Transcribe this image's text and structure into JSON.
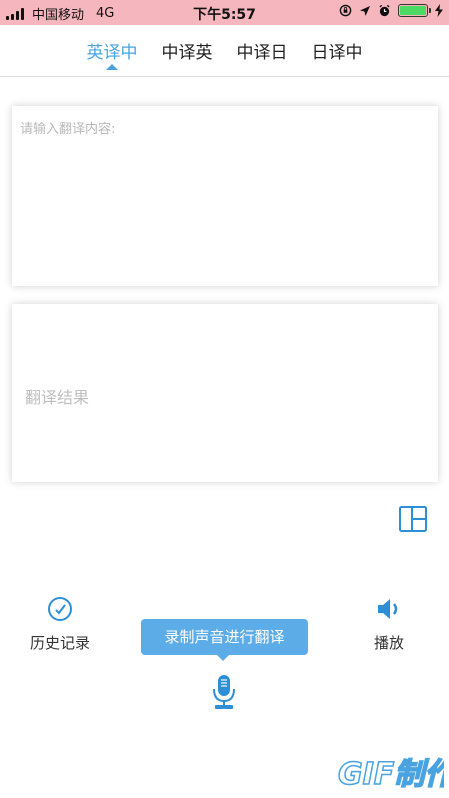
{
  "status_bar": {
    "carrier": "中国移动",
    "network": "4G",
    "time": "下午5:57",
    "battery_level": 1.0,
    "colors": {
      "background": "#f6b6bd",
      "battery": "#4cd964"
    },
    "icons": [
      "signal-icon",
      "rotation-lock-icon",
      "location-icon",
      "alarm-icon",
      "battery-icon",
      "charging-icon"
    ]
  },
  "tabs": {
    "items": [
      {
        "label": "英译中",
        "active": true
      },
      {
        "label": "中译英",
        "active": false
      },
      {
        "label": "中译日",
        "active": false
      },
      {
        "label": "日译中",
        "active": false
      }
    ],
    "accent_color": "#4aa3e0"
  },
  "input": {
    "placeholder": "请输入翻译内容:",
    "value": ""
  },
  "output": {
    "placeholder": "翻译结果"
  },
  "controls": {
    "history_label": "历史记录",
    "play_label": "播放",
    "record_tooltip": "录制声音进行翻译",
    "icons": [
      "layout-icon",
      "clock-icon",
      "speaker-icon",
      "microphone-icon"
    ],
    "accent_color": "#2d8fd5",
    "tooltip_color": "#5cace8"
  },
  "watermark": {
    "text": "GIF制作"
  }
}
